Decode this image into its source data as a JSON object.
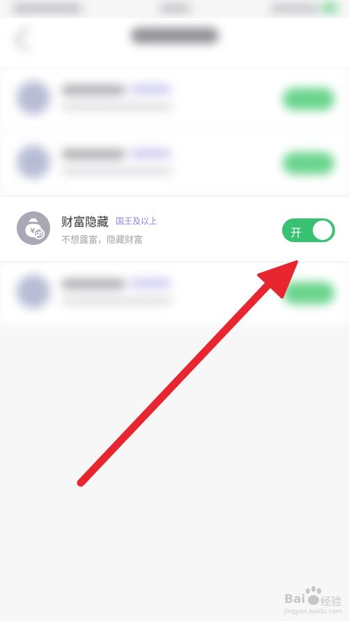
{
  "setting": {
    "title": "财富隐藏",
    "tag": "国王及以上",
    "subtitle": "不想露富，隐藏财富",
    "toggle_label": "开",
    "toggle_state": "on",
    "icon": "money-bag-hidden-icon"
  },
  "colors": {
    "toggle_on": "#38c172",
    "tag": "#8d7fe8",
    "arrow": "#e8262f",
    "avatar": "#a8a9b4"
  },
  "watermark": {
    "brand": "Bai",
    "brand_suffix": "经验",
    "url": "jingyan.baidu.com"
  }
}
